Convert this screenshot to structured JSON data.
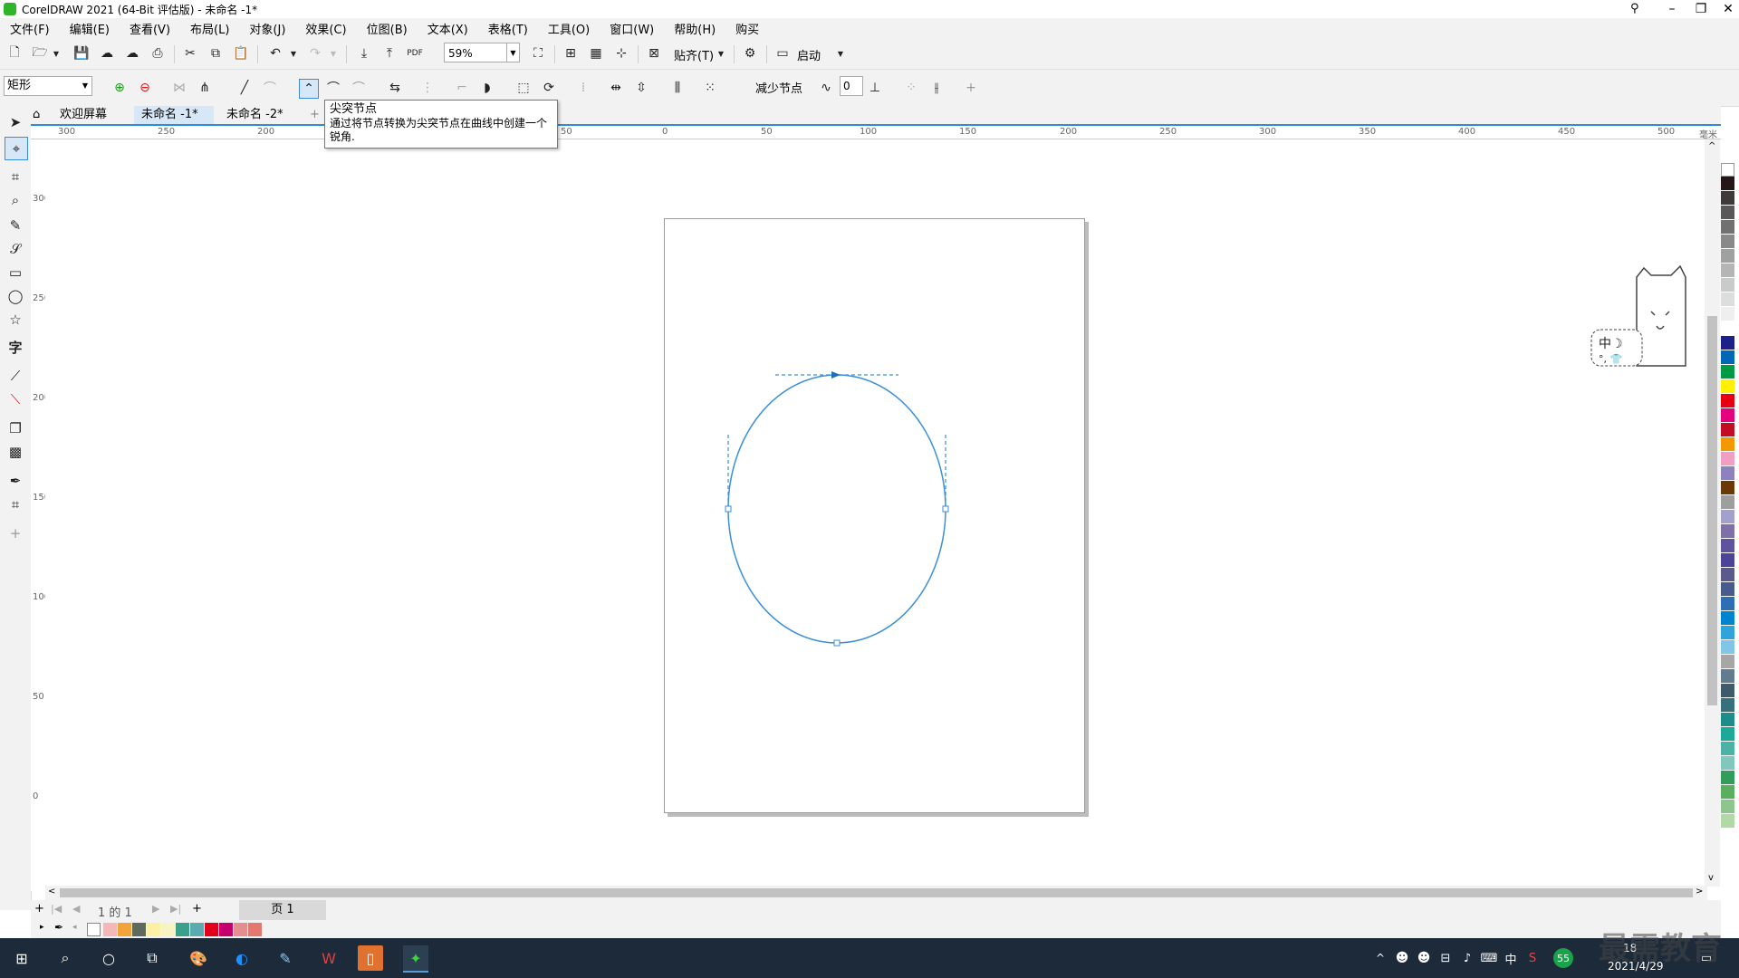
{
  "window": {
    "title": "CorelDRAW 2021 (64-Bit 评估版) - 未命名 -1*",
    "minimize": "–",
    "restore": "❐",
    "close": "✕"
  },
  "menu": [
    "文件(F)",
    "编辑(E)",
    "查看(V)",
    "布局(L)",
    "对象(J)",
    "效果(C)",
    "位图(B)",
    "文本(X)",
    "表格(T)",
    "工具(O)",
    "窗口(W)",
    "帮助(H)",
    "购买"
  ],
  "toolbar": {
    "zoom": "59%",
    "snap_label": "贴齐(T)",
    "launch_label": "启动",
    "pdf_label": "PDF"
  },
  "propbar": {
    "shape_select": "矩形",
    "reduce_nodes": "减少节点",
    "curve_smoothness": "0"
  },
  "tooltip": {
    "title": "尖突节点",
    "description": "通过将节点转换为尖突节点在曲线中创建一个锐角."
  },
  "tabs": [
    "欢迎屏幕",
    "未命名 -1*",
    "未命名 -2*"
  ],
  "hruler_labels": [
    "300",
    "250",
    "200",
    "150",
    "100",
    "50",
    "0",
    "50",
    "100",
    "150",
    "200",
    "250",
    "300",
    "350",
    "400",
    "450",
    "500"
  ],
  "hruler_units": "毫米",
  "vruler_labels": [
    "300",
    "250",
    "200",
    "150",
    "100",
    "50",
    "0"
  ],
  "pagebar": {
    "page_count": "1  的  1",
    "page_tab": "页 1"
  },
  "taskbar": {
    "time": "18",
    "date": "2021/4/29",
    "ime": "中"
  },
  "watermark": "最需教育",
  "palette_colors": [
    "#231815",
    "#3e3a39",
    "#595757",
    "#727171",
    "#898989",
    "#9fa0a0",
    "#b5b5b6",
    "#c9caca",
    "#dcdddd",
    "#efefef",
    "#ffffff",
    "#1d2088",
    "#0068b7",
    "#009944",
    "#fff100",
    "#e60012",
    "#e4007f",
    "#c30d23",
    "#f39800",
    "#f19ec2",
    "#8f82bc",
    "#6a3906",
    "#9e9e9f",
    "#a4a0cd",
    "#7e6fa9",
    "#5f52a0",
    "#4d4398",
    "#5a5a8c",
    "#475c8c",
    "#2e6eb4",
    "#0084cf",
    "#2fa4db",
    "#7fc6e8",
    "#a6a6a6",
    "#607c8e",
    "#3e5a6b",
    "#35717c",
    "#1e8c8c",
    "#1ea89a",
    "#4bb3a6",
    "#7ec8be",
    "#2f9e5a",
    "#58b05e",
    "#8cc68c",
    "#b0d9a6"
  ],
  "doc_palette_colors": [
    "#f4b8b8",
    "#f2a33a",
    "#5e6a5c",
    "#fbf0a3",
    "#f8f3c2",
    "#3aa08a",
    "#5aaab0",
    "#e2001a",
    "#c3006b",
    "#e48f8f",
    "#e2786e"
  ]
}
